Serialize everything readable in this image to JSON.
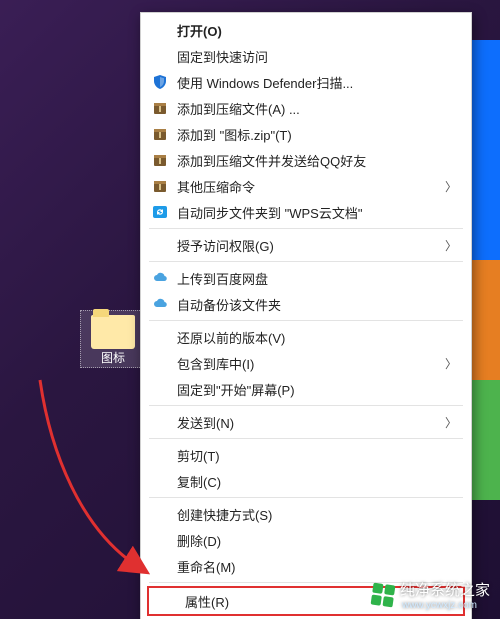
{
  "desktop": {
    "folder_label": "图标"
  },
  "menu": {
    "open": "打开(O)",
    "pin_quick": "固定到快速访问",
    "defender": "使用 Windows Defender扫描...",
    "add_archive": "添加到压缩文件(A) ...",
    "add_to_zip": "添加到 \"图标.zip\"(T)",
    "add_archive_qq": "添加到压缩文件并发送给QQ好友",
    "other_compress": "其他压缩命令",
    "wps_sync": "自动同步文件夹到 \"WPS云文档\"",
    "grant_access": "授予访问权限(G)",
    "upload_baidu": "上传到百度网盘",
    "auto_backup": "自动备份该文件夹",
    "restore_prev": "还原以前的版本(V)",
    "include_lib": "包含到库中(I)",
    "pin_start": "固定到\"开始\"屏幕(P)",
    "send_to": "发送到(N)",
    "cut": "剪切(T)",
    "copy": "复制(C)",
    "create_shortcut": "创建快捷方式(S)",
    "delete": "删除(D)",
    "rename": "重命名(M)",
    "properties": "属性(R)"
  },
  "watermark": {
    "text": "纯净系统之家",
    "url": "www.ycwxjz.com"
  }
}
